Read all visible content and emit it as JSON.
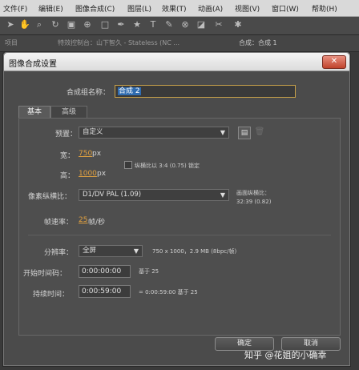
{
  "menubar": {
    "items": [
      "文件(F)",
      "编辑(E)",
      "图像合成(C)",
      "图层(L)",
      "效果(T)",
      "动画(A)",
      "视图(V)",
      "窗口(W)",
      "帮助(H)"
    ]
  },
  "panels": {
    "left_tab": "项目",
    "middle_tab": "特效控制台：山下智久 - Stateless (NC ...",
    "right_tab": "合成：合成 1"
  },
  "dialog": {
    "title": "图像合成设置",
    "close_icon": "✕",
    "name_label": "合成组名称：",
    "name_value": "合成 2",
    "tabs": [
      "基本",
      "高级"
    ],
    "preset_label": "预置：",
    "preset_value": "自定义",
    "width_label": "宽：",
    "width_value": "750",
    "width_unit": "px",
    "height_label": "高：",
    "height_value": "1000",
    "height_unit": "px",
    "lock_aspect": "纵横比以 3:4 (0.75) 锁定",
    "par_label": "像素纵横比：",
    "par_value": "D1/DV PAL (1.09)",
    "frame_aspect_label": "画面纵横比：",
    "frame_aspect_value": "32:39 (0.82)",
    "framerate_label": "帧速率：",
    "framerate_value": "25",
    "framerate_unit": "帧/秒",
    "resolution_label": "分辨率：",
    "resolution_value": "全屏",
    "resolution_info": "750 x 1000，2.9 MB (8bpc/帧)",
    "start_label": "开始时间码：",
    "start_value": "0:00:00:00",
    "start_base": "基于 25",
    "duration_label": "持续时间：",
    "duration_value": "0:00:59:00",
    "duration_info": "= 0:00:59:00  基于 25",
    "ok_label": "确定",
    "cancel_label": "取消"
  },
  "watermark": "知乎 @花姐的小确幸",
  "colors": {
    "accent_field": "#2f6cb0",
    "value_orange": "#e0a040",
    "close_red": "#c0432c"
  }
}
